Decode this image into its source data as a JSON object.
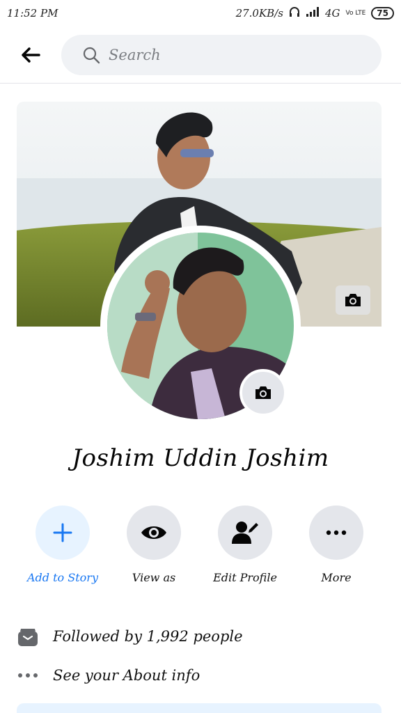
{
  "status_bar": {
    "time": "11:52 PM",
    "net_speed": "27.0KB/s",
    "network": "4G",
    "volte": "Vo LTE",
    "battery": "75"
  },
  "header": {
    "search_placeholder": "Search"
  },
  "profile": {
    "name": "Joshim Uddin Joshim"
  },
  "actions": [
    {
      "label": "Add to Story",
      "icon": "plus-icon"
    },
    {
      "label": "View as",
      "icon": "eye-icon"
    },
    {
      "label": "Edit Profile",
      "icon": "edit-profile-icon"
    },
    {
      "label": "More",
      "icon": "more-icon"
    }
  ],
  "info": {
    "followed_by": "Followed by 1,992 people",
    "about": "See your About info"
  },
  "colors": {
    "accent": "#1877f2",
    "accent_light": "#e7f3ff",
    "button_gray": "#e4e6eb",
    "search_bg": "#f0f2f5"
  }
}
